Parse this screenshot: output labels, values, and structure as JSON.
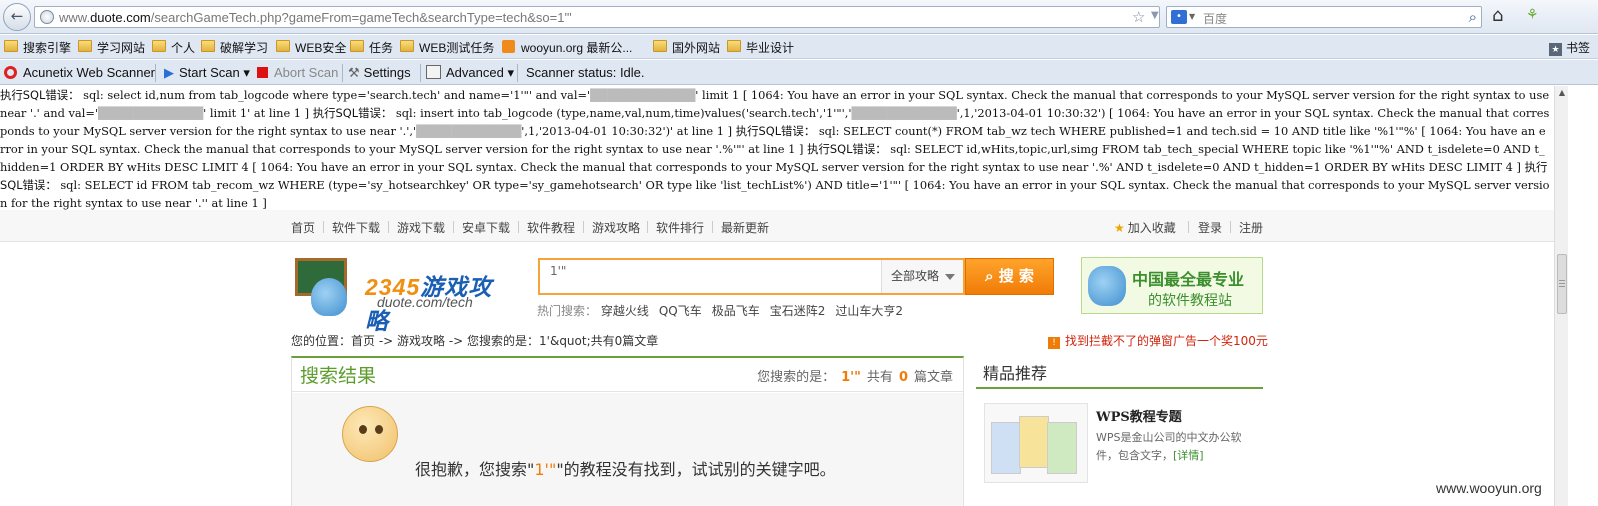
{
  "browser": {
    "url_prefix": "www.",
    "url_domain": "duote.com",
    "url_path": "/searchGameTech.php?gameFrom=gameTech&searchType=tech&so=1'\"",
    "search_placeholder": "百度"
  },
  "bookmarks": {
    "items": [
      "搜索引擎",
      "学习网站",
      "个人",
      "破解学习",
      "WEB安全",
      "任务",
      "WEB测试任务",
      "wooyun.org 最新公...",
      "国外网站",
      "毕业设计"
    ],
    "right_label": "书签"
  },
  "scanner_toolbar": {
    "brand": "Acunetix Web Scanner",
    "start_scan": "Start Scan",
    "abort_scan": "Abort Scan",
    "settings": "Settings",
    "advanced": "Advanced",
    "status": "Scanner status: Idle."
  },
  "errors": {
    "label": "执行SQL错误：",
    "sql1": " sql: select id,num from tab_logcode where type='search.tech' and name='1'\"' and val='",
    "sql1b": "' limit 1 [ 1064: You have an error in your SQL syntax. Check the manual that corresponds to your MySQL server version for the right syntax to use near '.' and val='",
    "sql1c": "' limit 1' at line 1 ] ",
    "sql2": " sql: insert into tab_logcode (type,name,val,num,time)values('search.tech','1'\"','",
    "sql2b": "',1,'2013-04-01 10:30:32') [ 1064: You have an error in your SQL syntax. Check the manual that corresponds to your MySQL server version for the right syntax to use near '.','",
    "sql2c": "',1,'2013-04-01 10:30:32')' at line 1 ] ",
    "sql3": " sql: SELECT count(*) FROM tab_wz tech WHERE published=1 and tech.sid = 10 AND title like '%1'\"%' [ 1064: You have an error in your SQL syntax. Check the manual that corresponds to your MySQL server version for the right syntax to use near '.%'\"' at line 1 ] ",
    "sql4": " sql: SELECT id,wHits,topic,url,simg FROM tab_tech_special WHERE topic like '%1'\"%' AND t_isdelete=0 AND t_hidden=1 ORDER BY wHits DESC LIMIT 4 [ 1064: You have an error in your SQL syntax. Check the manual that corresponds to your MySQL server version for the right syntax to use near '.%' AND t_isdelete=0 AND t_hidden=1 ORDER BY wHits DESC LIMIT 4 ] ",
    "sql5": " sql: SELECT id FROM tab_recom_wz WHERE (type='sy_hotsearchkey' OR type='sy_gamehotsearch' OR type like 'list_techList%') AND title='1'\"' [ 1064: You have an error in your SQL syntax. Check the manual that corresponds to your MySQL server version for the right syntax to use near '.'' at line 1 ]"
  },
  "site_nav": {
    "items": [
      "首页",
      "软件下载",
      "游戏下载",
      "安卓下载",
      "软件教程",
      "游戏攻略",
      "软件排行",
      "最新更新"
    ],
    "favorite": "加入收藏",
    "login": "登录",
    "register": "注册"
  },
  "logo": {
    "num": "2345",
    "text": "游戏攻略",
    "sub": "duote.com/tech"
  },
  "search": {
    "value": "1'\"",
    "category": "全部攻略",
    "button": "搜 索",
    "hot_label": "热门搜索：",
    "hot": [
      "穿越火线",
      "QQ飞车",
      "极品飞车",
      "宝石迷阵2",
      "过山车大亨2"
    ]
  },
  "banner": {
    "line1": "中国最全最专业",
    "line2": "的软件教程站"
  },
  "breadcrumb": "您的位置：首页 -> 游戏攻略 -> 您搜索的是：1'&quot;共有0篇文章",
  "ad_link": "找到拦截不了的弹窗广告一个奖100元",
  "results": {
    "title": "搜索结果",
    "info_prefix": "您搜索的是：",
    "query": "1'\"",
    "info_mid": "共有",
    "count": "0",
    "info_suffix": "篇文章",
    "sorry_prefix": "很抱歉，您搜索\"",
    "sorry_query": "1'\"",
    "sorry_suffix": "\"的教程没有找到，试试别的关键字吧。"
  },
  "sidebar": {
    "title": "精品推荐",
    "wps_title": "WPS教程专题",
    "wps_desc": "WPS是金山公司的中文办公软件，包含文字，",
    "wps_more": "[详情]"
  },
  "watermark": "www.wooyun.org"
}
